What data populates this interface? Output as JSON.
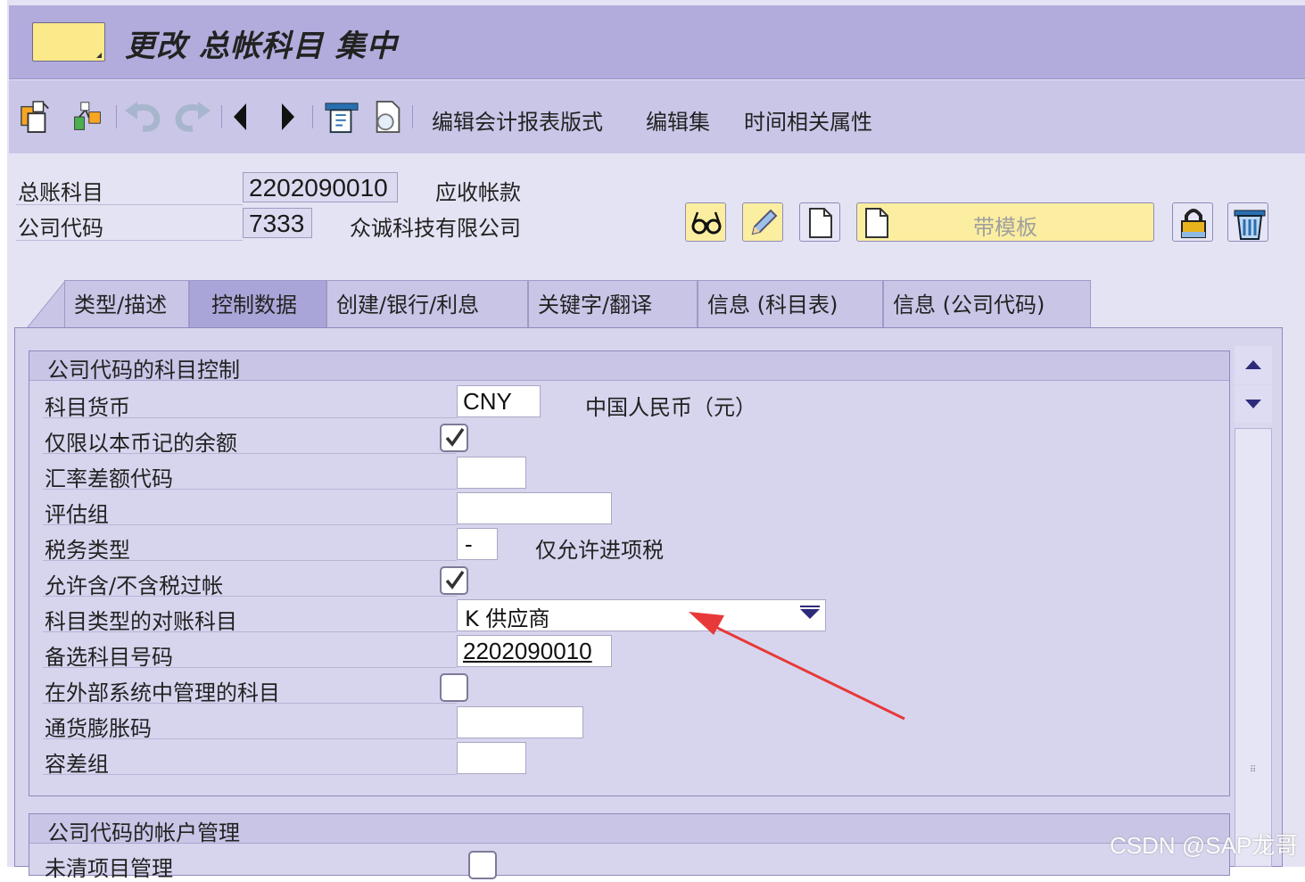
{
  "window": {
    "title": "更改 总帐科目 集中"
  },
  "toolbar": {
    "icons": [
      "display-change-icon",
      "hierarchy-icon",
      "undo-icon",
      "redo-icon",
      "previous-icon",
      "next-icon",
      "where-used-icon",
      "document-search-icon"
    ],
    "links": [
      "编辑会计报表版式",
      "编辑集",
      "时间相关属性"
    ]
  },
  "header": {
    "gl_account_label": "总账科目",
    "gl_account_value": "2202090010",
    "gl_account_desc": "应收帐款",
    "company_code_label": "公司代码",
    "company_code_value": "7333",
    "company_code_desc": "众诚科技有限公司",
    "template_button": "带模板"
  },
  "tabs": [
    "类型/描述",
    "控制数据",
    "创建/银行/利息",
    "关键字/翻译",
    "信息 (科目表)",
    "信息 (公司代码)"
  ],
  "active_tab": "控制数据",
  "account_control": {
    "title": "公司代码的科目控制",
    "fields": {
      "currency": {
        "label": "科目货币",
        "value": "CNY",
        "desc": "中国人民币（元）"
      },
      "only_local_balances": {
        "label": "仅限以本币记的余额",
        "checked": true
      },
      "exchange_rate_diff": {
        "label": "汇率差额代码",
        "value": ""
      },
      "valuation_group": {
        "label": "评估组",
        "value": ""
      },
      "tax_category": {
        "label": "税务类型",
        "value": "-",
        "desc": "仅允许进项税"
      },
      "posting_without_tax": {
        "label": "允许含/不含税过帐",
        "checked": true
      },
      "recon_account": {
        "label": "科目类型的对账科目",
        "value": "K 供应商"
      },
      "alt_account": {
        "label": "备选科目号码",
        "value": "2202090010"
      },
      "external_managed": {
        "label": "在外部系统中管理的科目",
        "checked": false
      },
      "inflation_key": {
        "label": "通货膨胀码",
        "value": ""
      },
      "tolerance_group": {
        "label": "容差组",
        "value": ""
      }
    }
  },
  "account_management": {
    "title": "公司代码的帐户管理",
    "partial_row_label": "未清项目管理"
  },
  "watermark": "CSDN @SAP龙哥",
  "colors": {
    "title_bar": "#b1acdc",
    "toolbar": "#c9c6e7",
    "panel": "#d7d5ee",
    "annotation_arrow": "#e8393a"
  }
}
